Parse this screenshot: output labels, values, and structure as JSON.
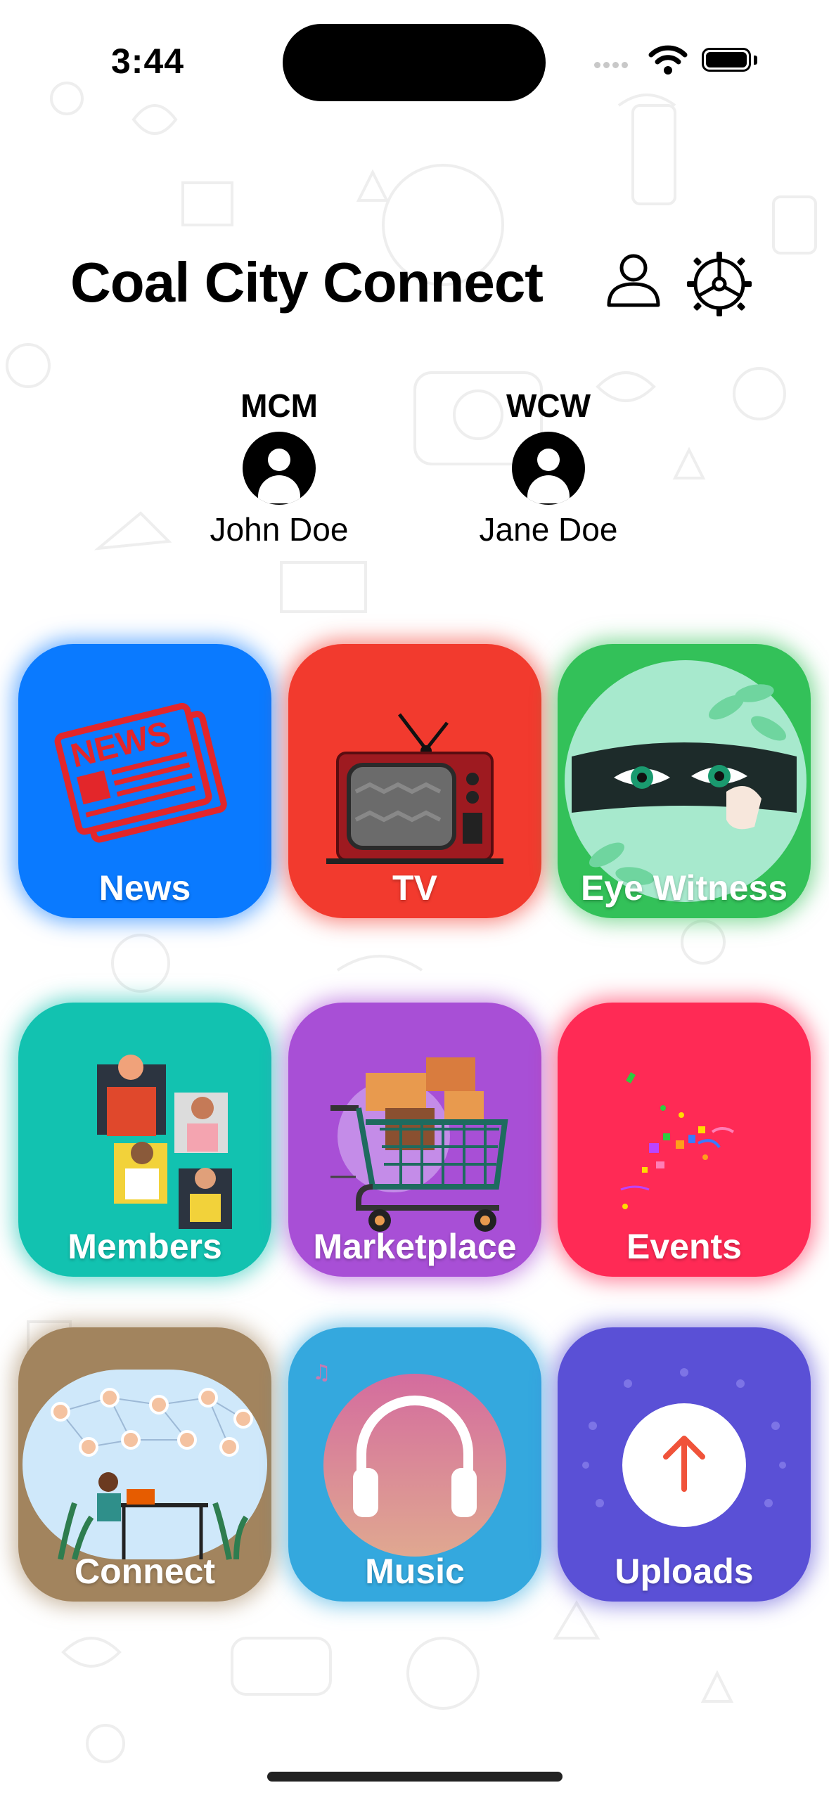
{
  "status_bar": {
    "time": "3:44"
  },
  "header": {
    "title": "Coal City Connect",
    "profile_icon": "person-outline-icon",
    "settings_icon": "steering-wheel-gear-icon"
  },
  "featured": [
    {
      "label": "MCM",
      "name": "John Doe",
      "icon": "person-circle-icon"
    },
    {
      "label": "WCW",
      "name": "Jane Doe",
      "icon": "person-circle-icon"
    }
  ],
  "tiles": [
    {
      "label": "News",
      "color": "#0A7AFF",
      "icon": "newspaper-icon"
    },
    {
      "label": "TV",
      "color": "#F23A2E",
      "icon": "retro-tv-icon"
    },
    {
      "label": "Eye Witness",
      "color": "#33C159",
      "icon": "peeking-eyes-icon"
    },
    {
      "label": "Members",
      "color": "#12C2B0",
      "icon": "members-group-icon"
    },
    {
      "label": "Marketplace",
      "color": "#A84FD6",
      "icon": "shopping-cart-icon"
    },
    {
      "label": "Events",
      "color": "#FF2A55",
      "icon": "confetti-icon"
    },
    {
      "label": "Connect",
      "color": "#A2845E",
      "icon": "network-people-icon"
    },
    {
      "label": "Music",
      "color": "#34A8DE",
      "icon": "headphones-icon"
    },
    {
      "label": "Uploads",
      "color": "#5A50D6",
      "icon": "upload-arrow-icon"
    }
  ]
}
